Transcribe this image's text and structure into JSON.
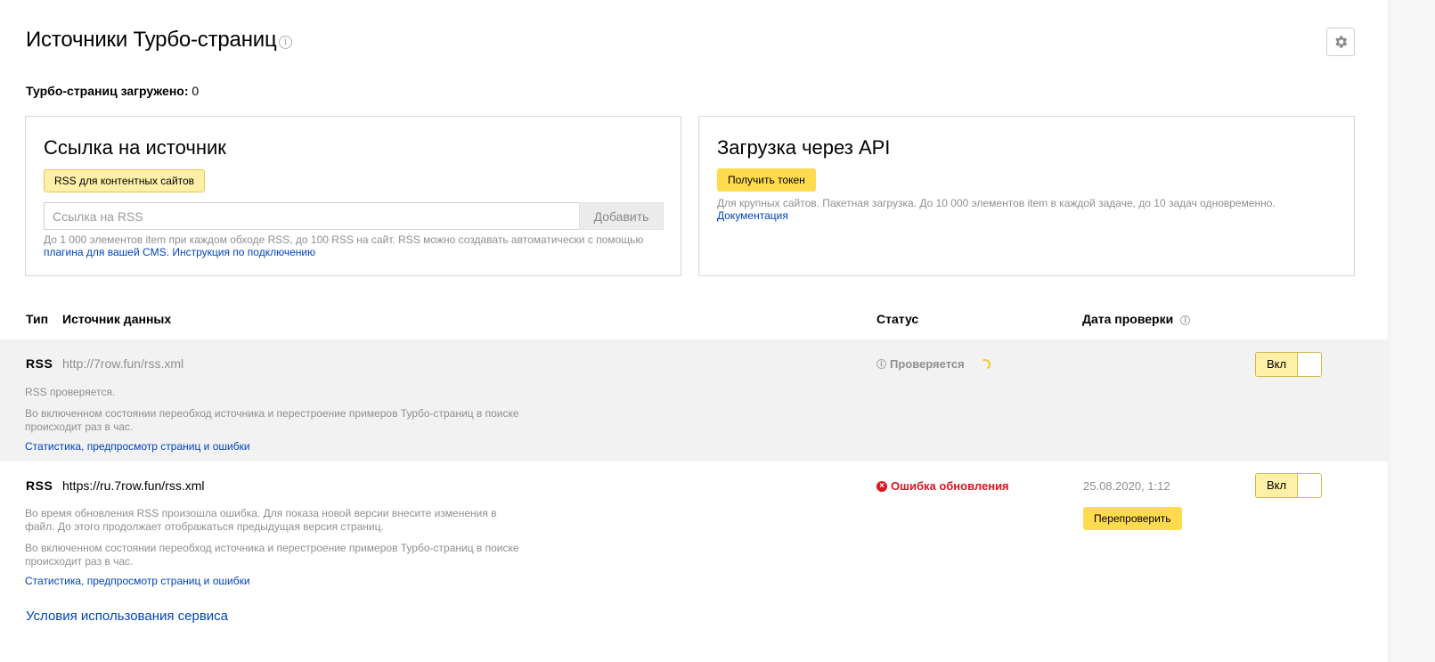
{
  "page": {
    "title": "Источники Турбо-страниц",
    "info_glyph": "i",
    "loaded_label": "Турбо-страниц загружено:",
    "loaded_count": "0"
  },
  "source_panel": {
    "title": "Ссылка на источник",
    "rss_button": "RSS для контентных сайтов",
    "input_placeholder": "Ссылка на RSS",
    "input_value": "",
    "add_button": "Добавить",
    "hint_text": "До 1 000 элементов item при каждом обходе RSS, до 100 RSS на сайт. RSS можно создавать автоматически с помощью",
    "plugin_link": "плагина для вашей CMS.",
    "instruction_link": "Инструкция по подключению"
  },
  "api_panel": {
    "title": "Загрузка через API",
    "token_button": "Получить токен",
    "hint_text": "Для крупных сайтов. Пакетная загрузка. До 10 000 элементов item в каждой задаче, до 10 задач одновременно.",
    "docs_link": "Документация"
  },
  "table": {
    "headers": {
      "type": "Тип",
      "source": "Источник данных",
      "status": "Статус",
      "date": "Дата проверки"
    },
    "rows": [
      {
        "type": "RSS",
        "url": "http://7row.fun/rss.xml",
        "message": "RSS проверяется.",
        "note": "Во включенном состоянии переобход источника и перестроение примеров Турбо-страниц в поиске происходит раз в час.",
        "link": "Статистика, предпросмотр страниц и ошибки",
        "status": "Проверяется",
        "date": "",
        "toggle": "Вкл"
      },
      {
        "type": "RSS",
        "url": "https://ru.7row.fun/rss.xml",
        "message": "Во время обновления RSS произошла ошибка. Для показа новой версии внесите изменения в файл. До этого продолжает отображаться предыдущая версия страниц.",
        "note": "Во включенном состоянии переобход источника и перестроение примеров Турбо-страниц в поиске происходит раз в час.",
        "link": "Статистика, предпросмотр страниц и ошибки",
        "status": "Ошибка обновления",
        "date": "25.08.2020, 1:12",
        "recheck_button": "Перепроверить",
        "toggle": "Вкл"
      }
    ]
  },
  "footer": {
    "terms_link": "Условия использования сервиса"
  },
  "colors": {
    "accent_yellow": "#ffdb4d",
    "pale_yellow": "#fff0a8",
    "link_blue": "#0044bb",
    "error_red": "#e0141e",
    "muted_gray": "#8f8f8f",
    "row_highlight": "#f2f2f2"
  },
  "icons": {
    "settings": "gear-icon",
    "info": "info-icon",
    "error": "error-circle-icon",
    "loading": "spinner-icon"
  }
}
